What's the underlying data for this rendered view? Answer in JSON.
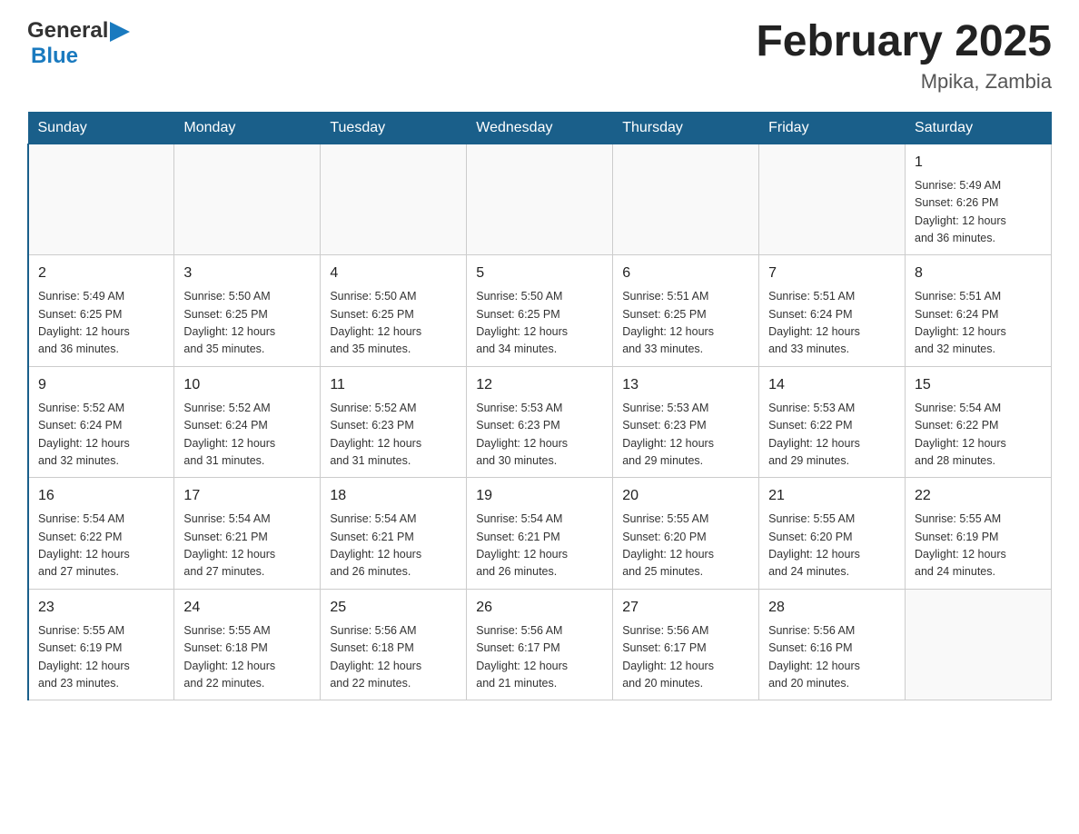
{
  "header": {
    "logo_general": "General",
    "logo_blue": "Blue",
    "main_title": "February 2025",
    "subtitle": "Mpika, Zambia"
  },
  "days_of_week": [
    "Sunday",
    "Monday",
    "Tuesday",
    "Wednesday",
    "Thursday",
    "Friday",
    "Saturday"
  ],
  "weeks": [
    [
      {
        "day": "",
        "info": ""
      },
      {
        "day": "",
        "info": ""
      },
      {
        "day": "",
        "info": ""
      },
      {
        "day": "",
        "info": ""
      },
      {
        "day": "",
        "info": ""
      },
      {
        "day": "",
        "info": ""
      },
      {
        "day": "1",
        "info": "Sunrise: 5:49 AM\nSunset: 6:26 PM\nDaylight: 12 hours\nand 36 minutes."
      }
    ],
    [
      {
        "day": "2",
        "info": "Sunrise: 5:49 AM\nSunset: 6:25 PM\nDaylight: 12 hours\nand 36 minutes."
      },
      {
        "day": "3",
        "info": "Sunrise: 5:50 AM\nSunset: 6:25 PM\nDaylight: 12 hours\nand 35 minutes."
      },
      {
        "day": "4",
        "info": "Sunrise: 5:50 AM\nSunset: 6:25 PM\nDaylight: 12 hours\nand 35 minutes."
      },
      {
        "day": "5",
        "info": "Sunrise: 5:50 AM\nSunset: 6:25 PM\nDaylight: 12 hours\nand 34 minutes."
      },
      {
        "day": "6",
        "info": "Sunrise: 5:51 AM\nSunset: 6:25 PM\nDaylight: 12 hours\nand 33 minutes."
      },
      {
        "day": "7",
        "info": "Sunrise: 5:51 AM\nSunset: 6:24 PM\nDaylight: 12 hours\nand 33 minutes."
      },
      {
        "day": "8",
        "info": "Sunrise: 5:51 AM\nSunset: 6:24 PM\nDaylight: 12 hours\nand 32 minutes."
      }
    ],
    [
      {
        "day": "9",
        "info": "Sunrise: 5:52 AM\nSunset: 6:24 PM\nDaylight: 12 hours\nand 32 minutes."
      },
      {
        "day": "10",
        "info": "Sunrise: 5:52 AM\nSunset: 6:24 PM\nDaylight: 12 hours\nand 31 minutes."
      },
      {
        "day": "11",
        "info": "Sunrise: 5:52 AM\nSunset: 6:23 PM\nDaylight: 12 hours\nand 31 minutes."
      },
      {
        "day": "12",
        "info": "Sunrise: 5:53 AM\nSunset: 6:23 PM\nDaylight: 12 hours\nand 30 minutes."
      },
      {
        "day": "13",
        "info": "Sunrise: 5:53 AM\nSunset: 6:23 PM\nDaylight: 12 hours\nand 29 minutes."
      },
      {
        "day": "14",
        "info": "Sunrise: 5:53 AM\nSunset: 6:22 PM\nDaylight: 12 hours\nand 29 minutes."
      },
      {
        "day": "15",
        "info": "Sunrise: 5:54 AM\nSunset: 6:22 PM\nDaylight: 12 hours\nand 28 minutes."
      }
    ],
    [
      {
        "day": "16",
        "info": "Sunrise: 5:54 AM\nSunset: 6:22 PM\nDaylight: 12 hours\nand 27 minutes."
      },
      {
        "day": "17",
        "info": "Sunrise: 5:54 AM\nSunset: 6:21 PM\nDaylight: 12 hours\nand 27 minutes."
      },
      {
        "day": "18",
        "info": "Sunrise: 5:54 AM\nSunset: 6:21 PM\nDaylight: 12 hours\nand 26 minutes."
      },
      {
        "day": "19",
        "info": "Sunrise: 5:54 AM\nSunset: 6:21 PM\nDaylight: 12 hours\nand 26 minutes."
      },
      {
        "day": "20",
        "info": "Sunrise: 5:55 AM\nSunset: 6:20 PM\nDaylight: 12 hours\nand 25 minutes."
      },
      {
        "day": "21",
        "info": "Sunrise: 5:55 AM\nSunset: 6:20 PM\nDaylight: 12 hours\nand 24 minutes."
      },
      {
        "day": "22",
        "info": "Sunrise: 5:55 AM\nSunset: 6:19 PM\nDaylight: 12 hours\nand 24 minutes."
      }
    ],
    [
      {
        "day": "23",
        "info": "Sunrise: 5:55 AM\nSunset: 6:19 PM\nDaylight: 12 hours\nand 23 minutes."
      },
      {
        "day": "24",
        "info": "Sunrise: 5:55 AM\nSunset: 6:18 PM\nDaylight: 12 hours\nand 22 minutes."
      },
      {
        "day": "25",
        "info": "Sunrise: 5:56 AM\nSunset: 6:18 PM\nDaylight: 12 hours\nand 22 minutes."
      },
      {
        "day": "26",
        "info": "Sunrise: 5:56 AM\nSunset: 6:17 PM\nDaylight: 12 hours\nand 21 minutes."
      },
      {
        "day": "27",
        "info": "Sunrise: 5:56 AM\nSunset: 6:17 PM\nDaylight: 12 hours\nand 20 minutes."
      },
      {
        "day": "28",
        "info": "Sunrise: 5:56 AM\nSunset: 6:16 PM\nDaylight: 12 hours\nand 20 minutes."
      },
      {
        "day": "",
        "info": ""
      }
    ]
  ]
}
